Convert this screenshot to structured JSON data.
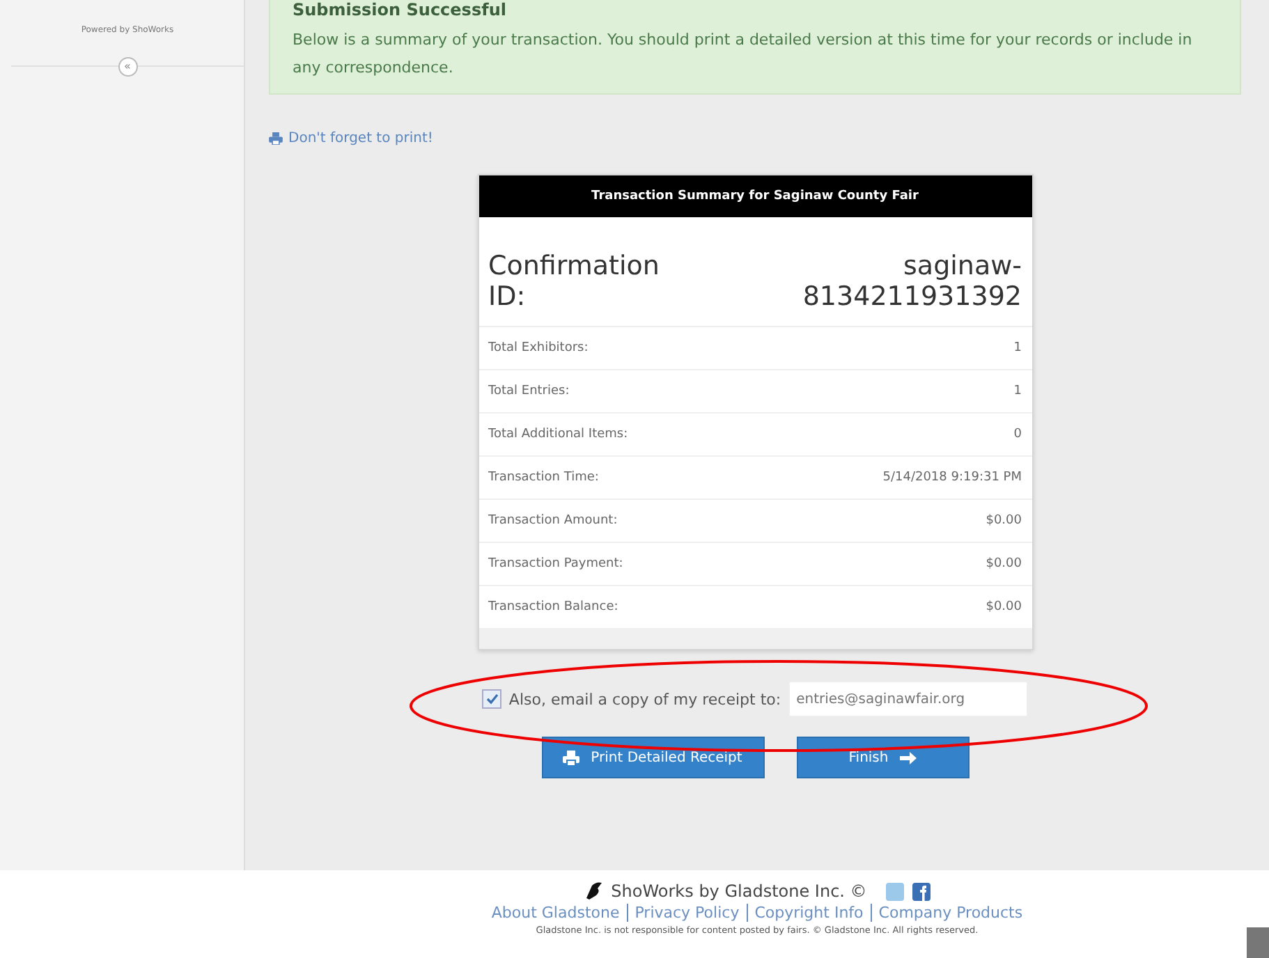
{
  "sidebar": {
    "powered_by": "Powered by ShoWorks",
    "collapse_glyph": "«"
  },
  "alert": {
    "title": "Submission Successful",
    "message": "Below is a summary of your transaction. You should print a detailed version at this time for your records or include in any correspondence."
  },
  "print_reminder": "Don't forget to print!",
  "summary": {
    "header": "Transaction Summary for Saginaw County Fair",
    "confirmation_label": "Confirmation ID:",
    "confirmation_id": "saginaw-8134211931392",
    "rows": [
      {
        "label": "Total Exhibitors:",
        "value": "1"
      },
      {
        "label": "Total Entries:",
        "value": "1"
      },
      {
        "label": "Total Additional Items:",
        "value": "0"
      },
      {
        "label": "Transaction Time:",
        "value": "5/14/2018 9:19:31 PM"
      },
      {
        "label": "Transaction Amount:",
        "value": "$0.00"
      },
      {
        "label": "Transaction Payment:",
        "value": "$0.00"
      },
      {
        "label": "Transaction Balance:",
        "value": "$0.00"
      }
    ]
  },
  "email": {
    "checked": true,
    "label": "Also, email a copy of my receipt to:",
    "placeholder": "entries@saginawfair.org"
  },
  "buttons": [
    {
      "kind": "print",
      "label": "Print Detailed Receipt"
    },
    {
      "kind": "finish",
      "label": "Finish"
    }
  ],
  "footer": {
    "brand": "ShoWorks by Gladstone Inc. ©",
    "links": [
      "About Gladstone",
      "Privacy Policy",
      "Copyright Info",
      "Company Products"
    ],
    "disclaimer": "Gladstone Inc. is not responsible for content posted by fairs. © Gladstone Inc. All rights reserved."
  }
}
